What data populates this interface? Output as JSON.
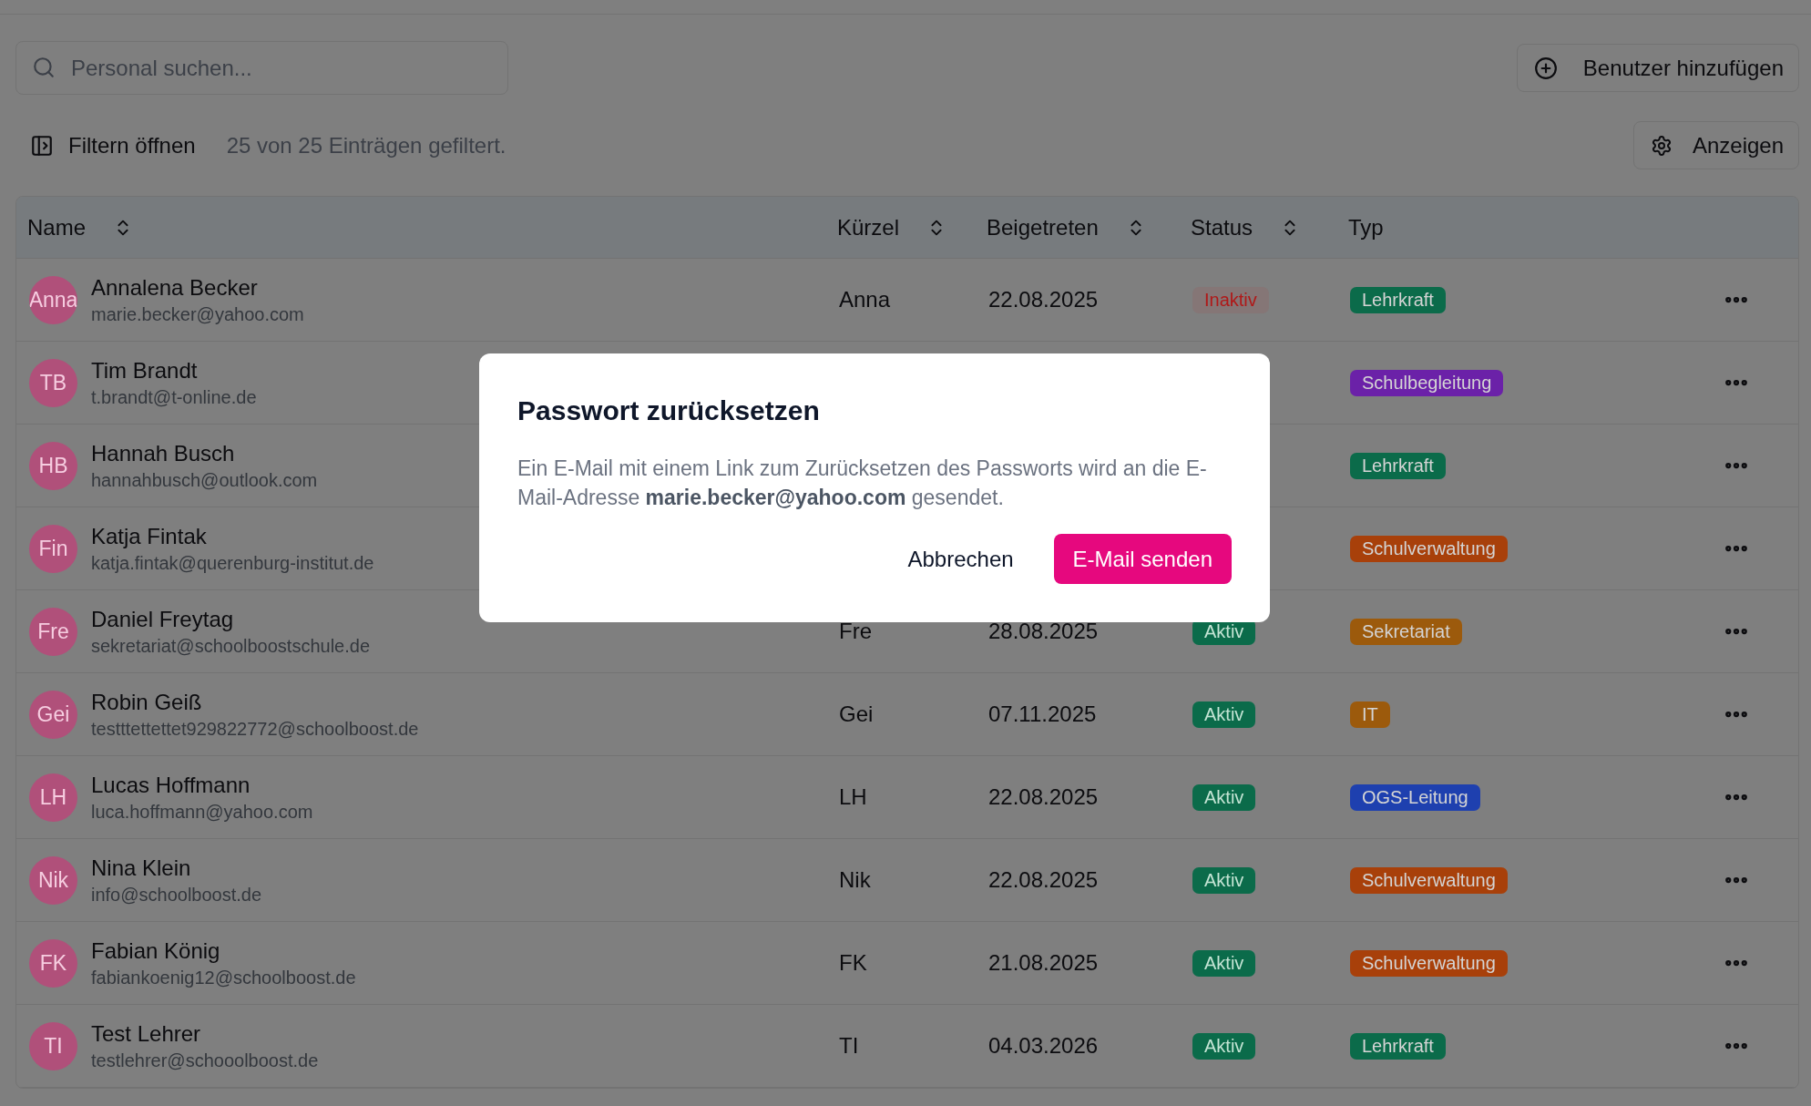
{
  "search": {
    "placeholder": "Personal suchen..."
  },
  "add_button": "Benutzer hinzufügen",
  "filter_button": "Filtern öffnen",
  "filter_summary": "25 von 25 Einträgen gefiltert.",
  "view_button": "Anzeigen",
  "table": {
    "columns": [
      {
        "label": "Name",
        "sortable": true
      },
      {
        "label": "Kürzel",
        "sortable": true
      },
      {
        "label": "Beigetreten",
        "sortable": true
      },
      {
        "label": "Status",
        "sortable": true
      },
      {
        "label": "Typ",
        "sortable": false
      }
    ],
    "rows": [
      {
        "initials": "Anna",
        "name": "Annalena Becker",
        "email": "marie.becker@yahoo.com",
        "kuerzel": "Anna",
        "joined": "22.08.2025",
        "status": {
          "label": "Inaktiv",
          "kind": "inactive"
        },
        "type": {
          "label": "Lehrkraft",
          "color": "#0b6b4a"
        }
      },
      {
        "initials": "TB",
        "name": "Tim Brandt",
        "email": "t.brandt@t-online.de",
        "type": {
          "label": "Schulbegleitung",
          "color": "#6b21a8"
        }
      },
      {
        "initials": "HB",
        "name": "Hannah Busch",
        "email": "hannahbusch@outlook.com",
        "type": {
          "label": "Lehrkraft",
          "color": "#0b6b4a"
        }
      },
      {
        "initials": "Fin",
        "name": "Katja Fintak",
        "email": "katja.fintak@querenburg-institut.de",
        "type": {
          "label": "Schulverwaltung",
          "color": "#a8400a"
        }
      },
      {
        "initials": "Fre",
        "name": "Daniel Freytag",
        "email": "sekretariat@schoolboostschule.de",
        "kuerzel": "Fre",
        "joined": "28.08.2025",
        "status": {
          "label": "Aktiv",
          "kind": "active"
        },
        "type": {
          "label": "Sekretariat",
          "color": "#9c5a0c"
        }
      },
      {
        "initials": "Gei",
        "name": "Robin Geiß",
        "email": "testttettettet929822772@schoolboost.de",
        "kuerzel": "Gei",
        "joined": "07.11.2025",
        "status": {
          "label": "Aktiv",
          "kind": "active"
        },
        "type": {
          "label": "IT",
          "color": "#9c5a0c"
        }
      },
      {
        "initials": "LH",
        "name": "Lucas Hoffmann",
        "email": "luca.hoffmann@yahoo.com",
        "kuerzel": "LH",
        "joined": "22.08.2025",
        "status": {
          "label": "Aktiv",
          "kind": "active"
        },
        "type": {
          "label": "OGS-Leitung",
          "color": "#1e40af"
        }
      },
      {
        "initials": "Nik",
        "name": "Nina Klein",
        "email": "info@schoolboost.de",
        "kuerzel": "Nik",
        "joined": "22.08.2025",
        "status": {
          "label": "Aktiv",
          "kind": "active"
        },
        "type": {
          "label": "Schulverwaltung",
          "color": "#a8400a"
        }
      },
      {
        "initials": "FK",
        "name": "Fabian König",
        "email": "fabiankoenig12@schoolboost.de",
        "kuerzel": "FK",
        "joined": "21.08.2025",
        "status": {
          "label": "Aktiv",
          "kind": "active"
        },
        "type": {
          "label": "Schulverwaltung",
          "color": "#a8400a"
        }
      },
      {
        "initials": "TI",
        "name": "Test Lehrer",
        "email": "testlehrer@schooolboost.de",
        "kuerzel": "TI",
        "joined": "04.03.2026",
        "status": {
          "label": "Aktiv",
          "kind": "active"
        },
        "type": {
          "label": "Lehrkraft",
          "color": "#0b6b4a"
        }
      }
    ]
  },
  "dialog": {
    "title": "Passwort zurücksetzen",
    "message": "Ein E-Mail mit einem Link zum Zurücksetzen des Passworts wird an die E-Mail-Adresse **marie.becker@yahoo.com** gesendet.",
    "cancel": "Abbrechen",
    "confirm": "E-Mail senden"
  }
}
